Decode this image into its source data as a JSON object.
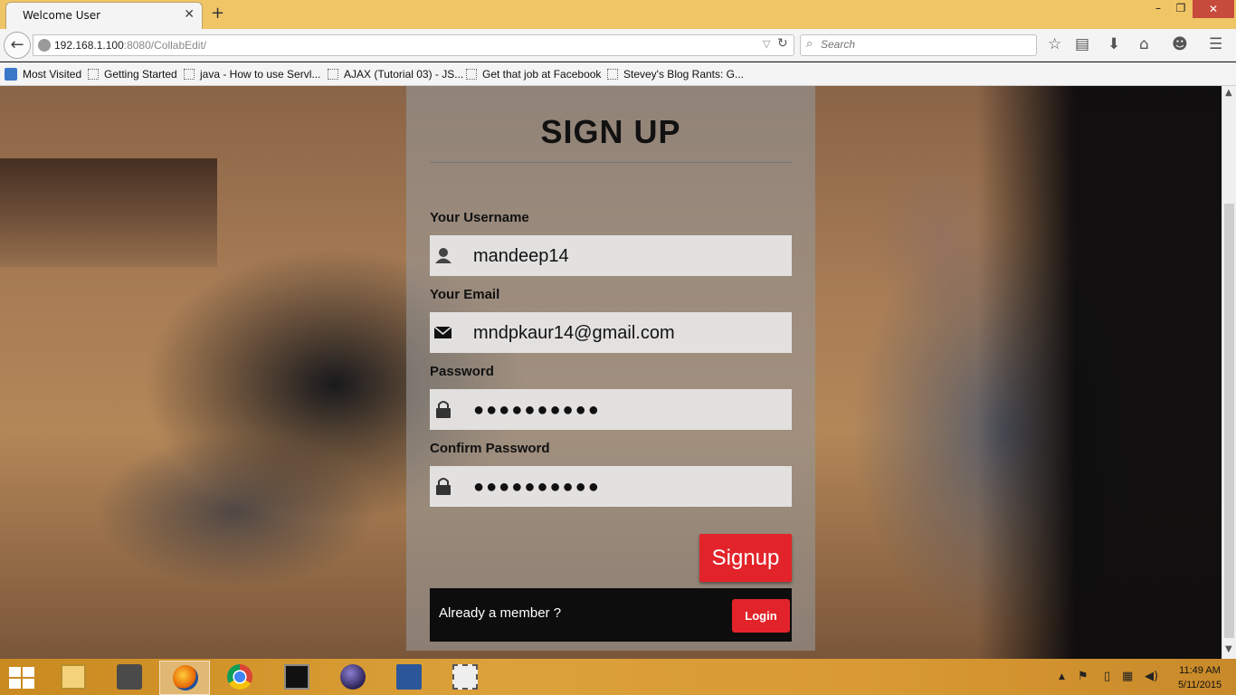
{
  "browser": {
    "tab_title": "Welcome User",
    "new_tab_glyph": "+",
    "url_host": "192.168.1.100",
    "url_rest": ":8080/CollabEdit/",
    "search_placeholder": "Search",
    "icons": [
      "back-icon",
      "globe-icon",
      "reload-icon",
      "search-icon",
      "bookmark-star-icon",
      "reading-list-icon",
      "download-icon",
      "home-icon",
      "smiley-icon",
      "menu-icon"
    ],
    "window_buttons": {
      "minimize": "–",
      "maximize": "❐",
      "close": "✕"
    }
  },
  "bookmarks": [
    {
      "label": "Most Visited"
    },
    {
      "label": "Getting Started"
    },
    {
      "label": "java - How to use Servl..."
    },
    {
      "label": "AJAX (Tutorial 03) - JS..."
    },
    {
      "label": "Get that job at Facebook"
    },
    {
      "label": "Stevey's Blog Rants: G..."
    }
  ],
  "form": {
    "title": "SIGN UP",
    "username_label": "Your Username",
    "username_value": "mandeep14",
    "email_label": "Your Email",
    "email_value": "mndpkaur14@gmail.com",
    "password_label": "Password",
    "password_value": "●●●●●●●●●●",
    "confirm_label": "Confirm Password",
    "confirm_value": "●●●●●●●●●●",
    "signup_button": "Signup",
    "member_text": "Already a member ?",
    "login_button": "Login"
  },
  "colors": {
    "accent_red": "#e2242a",
    "taskbar": "#dca13a",
    "titlebar": "#f0c565"
  },
  "taskbar": {
    "apps": [
      "file-explorer",
      "sublime-text",
      "firefox",
      "chrome",
      "command-prompt",
      "eclipse",
      "word",
      "snipping-tool"
    ],
    "active_app": "firefox",
    "time": "11:49 AM",
    "date": "5/11/2015"
  }
}
